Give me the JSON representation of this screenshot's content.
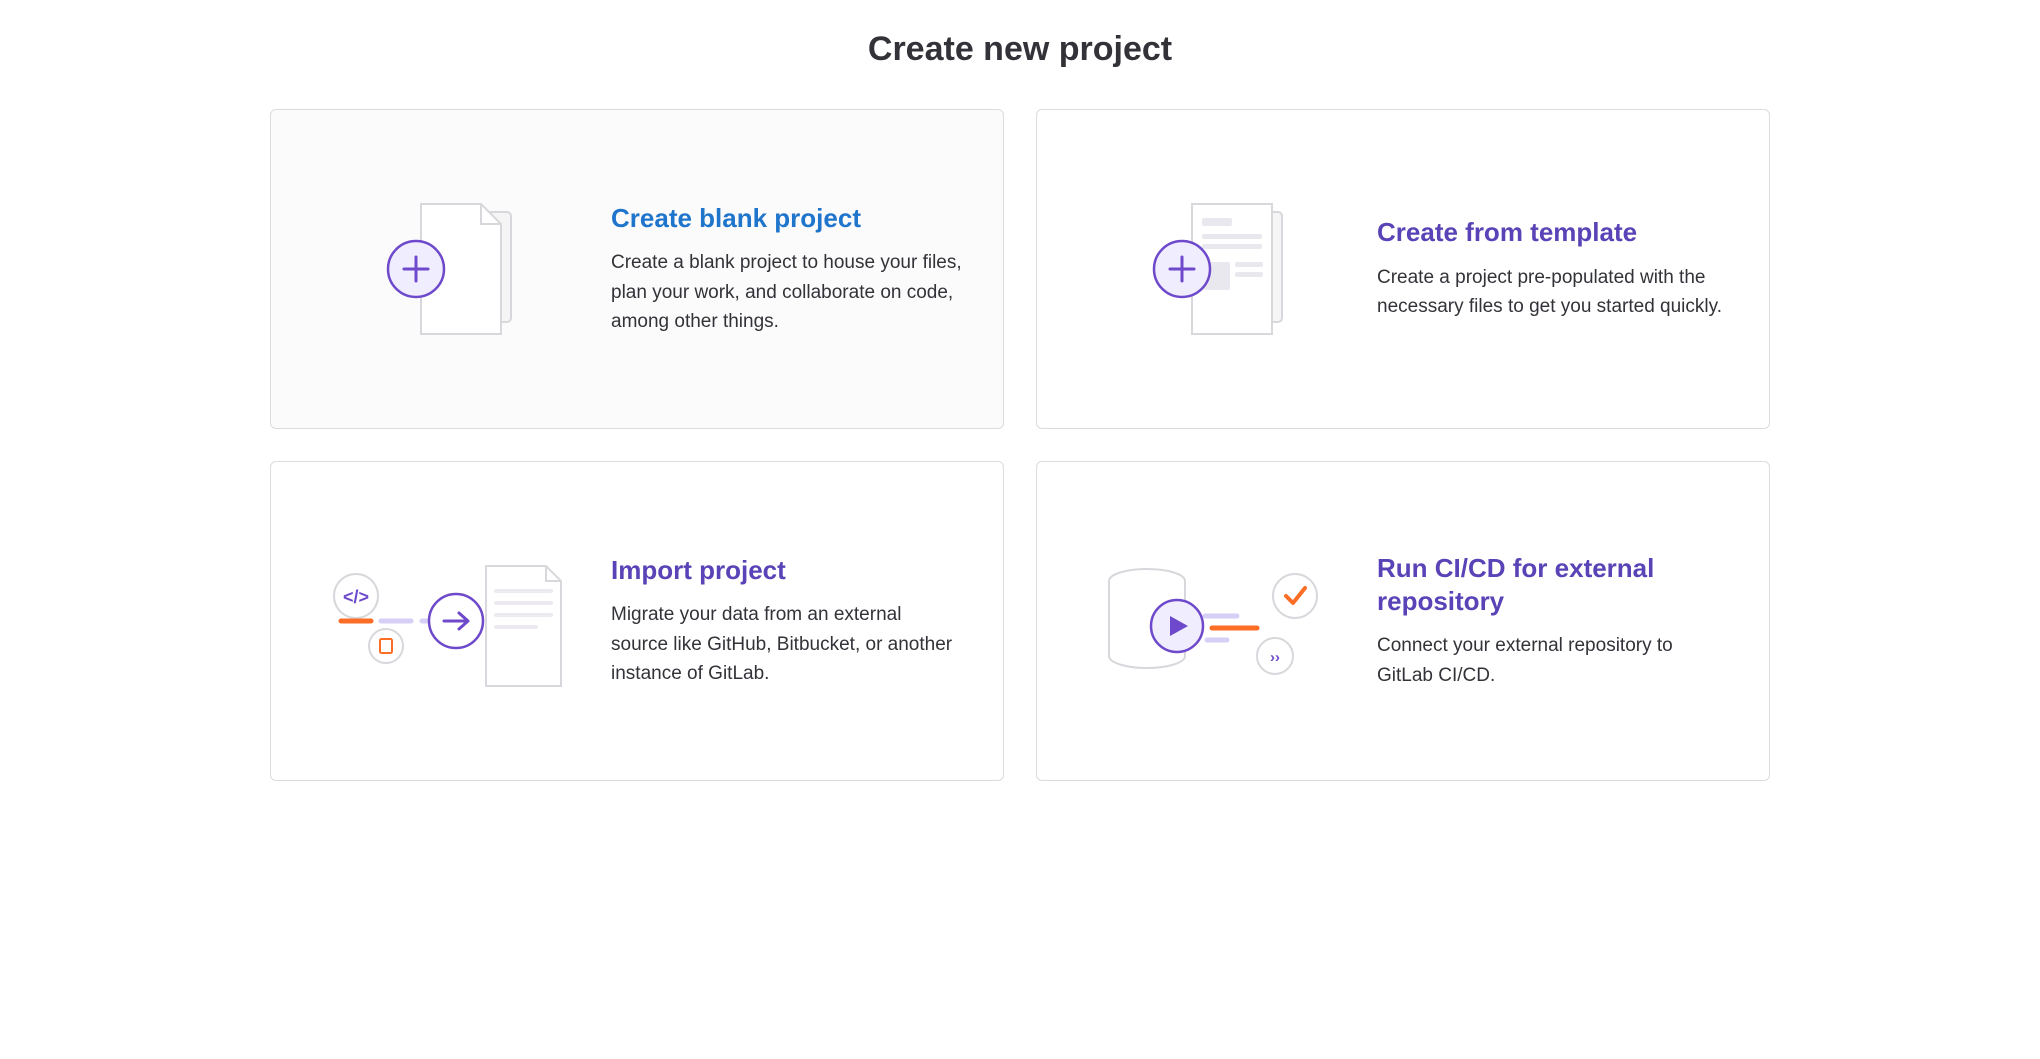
{
  "page": {
    "title": "Create new project"
  },
  "cards": {
    "blank": {
      "title": "Create blank project",
      "desc": "Create a blank project to house your files, plan your work, and collaborate on code, among other things."
    },
    "template": {
      "title": "Create from template",
      "desc": "Create a project pre-populated with the necessary files to get you started quickly."
    },
    "import": {
      "title": "Import project",
      "desc": "Migrate your data from an external source like GitHub, Bitbucket, or another instance of GitLab."
    },
    "cicd": {
      "title": "Run CI/CD for external repository",
      "desc": "Connect your external repository to GitLab CI/CD."
    }
  }
}
